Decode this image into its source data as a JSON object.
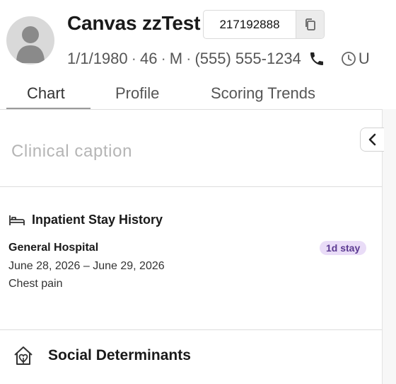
{
  "patient": {
    "name": "Canvas zzTest",
    "mrn": "217192888",
    "dob": "1/1/1980",
    "age": "46",
    "sex": "M",
    "phone": "(555) 555-1234",
    "separator": "·",
    "truncated_next": "U"
  },
  "tabs": [
    {
      "label": "Chart",
      "active": true
    },
    {
      "label": "Profile",
      "active": false
    },
    {
      "label": "Scoring Trends",
      "active": false
    }
  ],
  "caption": {
    "placeholder": "Clinical caption"
  },
  "inpatient": {
    "title": "Inpatient Stay History",
    "stays": [
      {
        "hospital": "General Hospital",
        "badge": "1d stay",
        "dates": "June 28, 2026 – June 29, 2026",
        "reason": "Chest pain"
      }
    ]
  },
  "social_determinants": {
    "title": "Social Determinants"
  },
  "icons": {
    "copy": "copy-icon",
    "phone": "phone-icon",
    "clock": "clock-icon",
    "collapse": "chevron-left-icon",
    "bed": "bed-icon",
    "home_heart": "house-heart-icon"
  },
  "colors": {
    "badge_bg": "#e9dcf7",
    "badge_text": "#5b3a91"
  }
}
